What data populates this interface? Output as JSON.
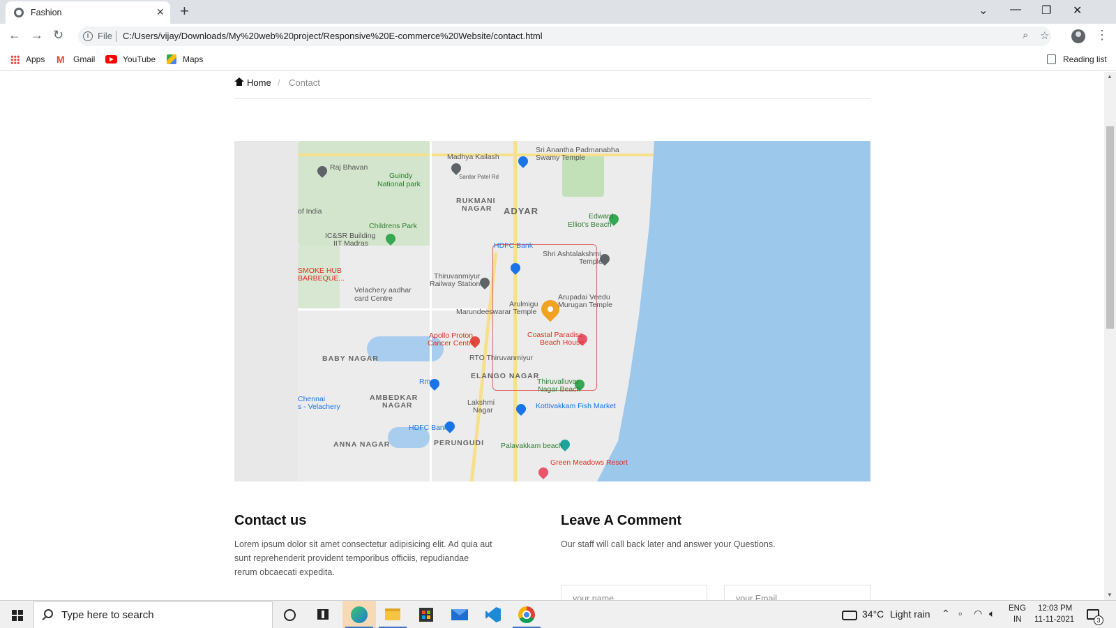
{
  "browser": {
    "tab_title": "Fashion",
    "tab_close": "✕",
    "new_tab": "+",
    "window_controls": [
      "⌄",
      "—",
      "❐",
      "✕"
    ],
    "file_label": "File",
    "url": "C:/Users/vijay/Downloads/My%20web%20project/Responsive%20E-commerce%20Website/contact.html",
    "bookmarks": [
      "Apps",
      "Gmail",
      "YouTube",
      "Maps"
    ],
    "reading_list": "Reading list",
    "icons": [
      "back-arrow",
      "forward-arrow",
      "reload",
      "info",
      "zoom",
      "star",
      "profile",
      "menu-kebab"
    ]
  },
  "breadcrumb": {
    "home": "Home",
    "separator": "/",
    "current": "Contact"
  },
  "map": {
    "labels": {
      "madhya_kailash": "Madhya Kailash",
      "sri_anantha": "Sri Anantha Padmanabha",
      "swamy_temple": "Swamy Temple",
      "raj_bhavan": "Raj Bhavan",
      "guindy": "Guindy",
      "national_park": "National park",
      "sardar_patel": "Sardar Patel Rd",
      "rukmani": "RUKMANI",
      "nagar": "NAGAR",
      "adyar": "ADYAR",
      "edward": "Edward",
      "elliots_beach": "Elliot's Beach",
      "of_india": "of India",
      "childrens_park": "Childrens Park",
      "icsr": "IC&SR Building",
      "iit_madras": "IIT Madras",
      "hdfc_bank": "HDFC Bank",
      "shri_ashtalakshmi": "Shri Ashtalakshmi",
      "temple": "Temple",
      "smoke_hub": "SMOKE HUB",
      "barbeque": "BARBEQUE...",
      "thiruvanmiyur": "Thiruvanmiyur",
      "railway_station": "Railway Station",
      "velachery_aadhar": "Velachery aadhar",
      "card_centre": "card Centre",
      "arupadai": "Arupadai Veedu",
      "murugan_temple": "Murugan Temple",
      "arulmigu": "Arulmigu",
      "marundeeswarar": "Marundeeswarar Temple",
      "apollo": "Apollo Proton",
      "cancer_centre": "Cancer Centre",
      "coastal_paradise": "Coastal Paradise",
      "beach_house": "Beach House",
      "baby_nagar": "BABY NAGAR",
      "rto": "RTO Thiruvanmiyur",
      "elango_nagar": "ELANGO NAGAR",
      "rmz": "Rmz",
      "thiruvalluvar": "Thiruvalluvar",
      "nagar_beach": "Nagar Beach",
      "chennai": "Chennai",
      "velachery": "s - Velachery",
      "ambedkar": "AMBEDKAR",
      "lakshmi": "Lakshmi",
      "lakshmi_nagar": "Nagar",
      "kottivakkam": "Kottivakkam Fish Market",
      "hdfc_bank_2": "HDFC Bank",
      "perungudi": "PERUNGUDI",
      "anna_nagar": "ANNA NAGAR",
      "palavakkam": "Palavakkam beach",
      "green_meadows": "Green Meadows Resort"
    }
  },
  "contact": {
    "title": "Contact us",
    "text": "Lorem ipsum dolor sit amet consectetur adipisicing elit. Ad quia aut sunt reprehenderit provident temporibus officiis, repudiandae rerum obcaecati expedita."
  },
  "comment": {
    "title": "Leave A Comment",
    "subtitle": "Our staff will call back later and answer your Questions.",
    "name_placeholder": "your name",
    "email_placeholder": "your Email"
  },
  "taskbar": {
    "search_placeholder": "Type here to search",
    "weather_temp": "34°C",
    "weather_desc": "Light rain",
    "lang_top": "ENG",
    "lang_bottom": "IN",
    "time": "12:03 PM",
    "date": "11-11-2021",
    "notification_count": "3"
  }
}
